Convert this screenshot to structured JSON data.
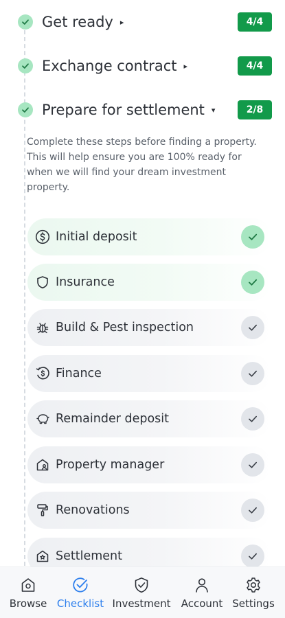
{
  "sections": [
    {
      "title": "Get ready",
      "badge": "4/4",
      "caret": "▸"
    },
    {
      "title": "Exchange contract",
      "badge": "4/4",
      "caret": "▸"
    },
    {
      "title": "Prepare for settlement",
      "badge": "2/8",
      "caret": "▾"
    }
  ],
  "description": "Complete these steps before finding a property. This will help ensure you are 100% ready for when we will find your dream investment property.",
  "tasks": [
    {
      "label": "Initial deposit",
      "status": "complete",
      "icon": "dollar-circle-icon"
    },
    {
      "label": "Insurance",
      "status": "complete",
      "icon": "shield-icon"
    },
    {
      "label": "Build & Pest inspection",
      "status": "incomplete",
      "icon": "bug-icon"
    },
    {
      "label": "Finance",
      "status": "incomplete",
      "icon": "finance-icon"
    },
    {
      "label": "Remainder deposit",
      "status": "incomplete",
      "icon": "piggy-bank-icon"
    },
    {
      "label": "Property manager",
      "status": "incomplete",
      "icon": "house-person-icon"
    },
    {
      "label": "Renovations",
      "status": "incomplete",
      "icon": "paint-roller-icon"
    },
    {
      "label": "Settlement",
      "status": "incomplete",
      "icon": "house-star-icon"
    }
  ],
  "bottom_nav": [
    {
      "label": "Browse",
      "icon": "home-icon",
      "active": false
    },
    {
      "label": "Checklist",
      "icon": "checklist-icon",
      "active": true
    },
    {
      "label": "Investment",
      "icon": "investment-icon",
      "active": false
    },
    {
      "label": "Account",
      "icon": "account-icon",
      "active": false
    },
    {
      "label": "Settings",
      "icon": "settings-icon",
      "active": false
    }
  ],
  "colors": {
    "brand_green": "#129a4a",
    "check_green": "#a7e6c1",
    "active_blue": "#2f80ed",
    "text": "#2d3138"
  }
}
